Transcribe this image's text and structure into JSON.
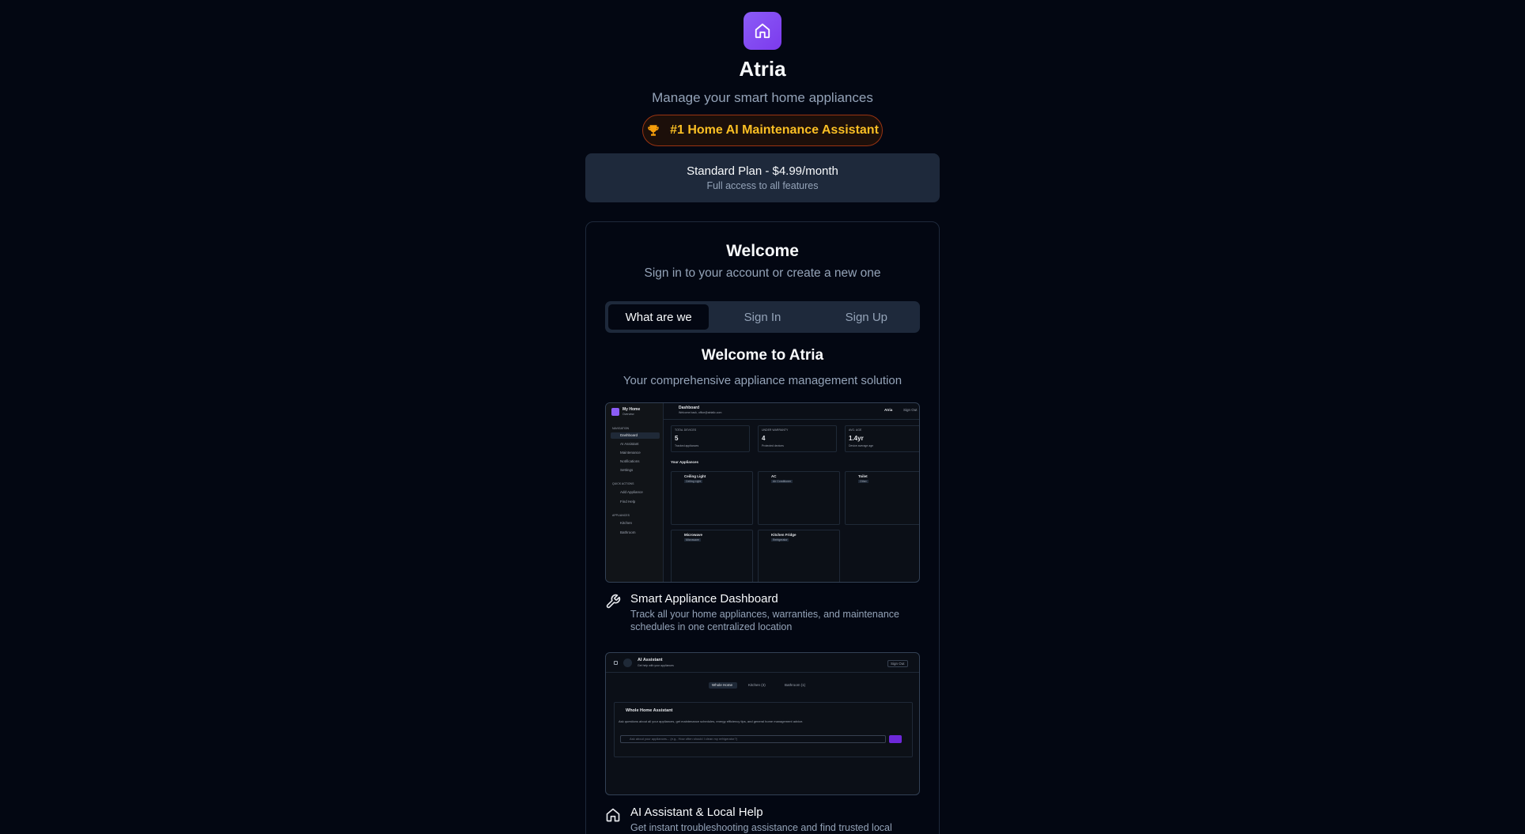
{
  "app": {
    "title": "Atria",
    "subtitle": "Manage your smart home appliances",
    "badge": "#1 Home AI Maintenance Assistant",
    "logo_icon": "home-icon",
    "accent": "#8b5cf6",
    "badge_color": "#fbbf24"
  },
  "plan": {
    "title": "Standard Plan - $4.99/month",
    "subtitle": "Full access to all features"
  },
  "auth": {
    "title": "Welcome",
    "subtitle": "Sign in to your account or create a new one",
    "tabs": [
      {
        "label": "What are we",
        "active": true
      },
      {
        "label": "Sign In",
        "active": false
      },
      {
        "label": "Sign Up",
        "active": false
      }
    ]
  },
  "about": {
    "title": "Welcome to Atria",
    "subtitle": "Your comprehensive appliance management solution",
    "features": [
      {
        "icon": "wrench-icon",
        "title": "Smart Appliance Dashboard",
        "description": "Track all your home appliances, warranties, and maintenance schedules in one centralized location"
      },
      {
        "icon": "home-icon",
        "title": "AI Assistant & Local Help",
        "description": "Get instant troubleshooting assistance and find trusted local"
      }
    ]
  },
  "preview_dashboard": {
    "brand": "My Home",
    "brand_sub": "Overview",
    "page_title": "Dashboard",
    "page_sub": "Welcome back, office@atriallc.com",
    "top_right": "Atria",
    "sign_out": "Sign Out",
    "nav_heading": "NAVIGATION",
    "nav": [
      "Dashboard",
      "AI Assistant",
      "Maintenance",
      "Notifications",
      "Settings"
    ],
    "quick_heading": "QUICK ACTIONS",
    "quick": [
      "Add Appliance",
      "Find Help"
    ],
    "appl_heading": "APPLIANCES",
    "rooms": [
      "Kitchen",
      "Bathroom"
    ],
    "stats": [
      {
        "label": "TOTAL DEVICES",
        "value": "5",
        "sub": "Tracked appliances"
      },
      {
        "label": "UNDER WARRANTY",
        "value": "4",
        "sub": "Protected devices"
      },
      {
        "label": "AVG. AGE",
        "value": "1.4yr",
        "sub": "Device average age"
      }
    ],
    "section": "Your Appliances",
    "cards": [
      {
        "name": "Ceiling Light",
        "tag": "Ceiling Light"
      },
      {
        "name": "AC",
        "tag": "Air Conditioner"
      },
      {
        "name": "Toilet",
        "tag": "Other"
      },
      {
        "name": "Microwave",
        "tag": "Microwave"
      },
      {
        "name": "Kitchen Fridge",
        "tag": "Refrigerator"
      }
    ]
  },
  "preview_assistant": {
    "title": "AI Assistant",
    "subtitle": "Get help with your appliances",
    "sign_out": "Sign Out",
    "tabs": [
      "Whole Home",
      "Kitchen (3)",
      "Bathroom (1)"
    ],
    "panel_title": "Whole Home Assistant",
    "panel_desc": "Ask questions about all your appliances, get maintenance schedules, energy efficiency tips, and general home management advice.",
    "input_placeholder": "Ask about your appliances... (e.g., How often should I clean my refrigerator?)"
  }
}
